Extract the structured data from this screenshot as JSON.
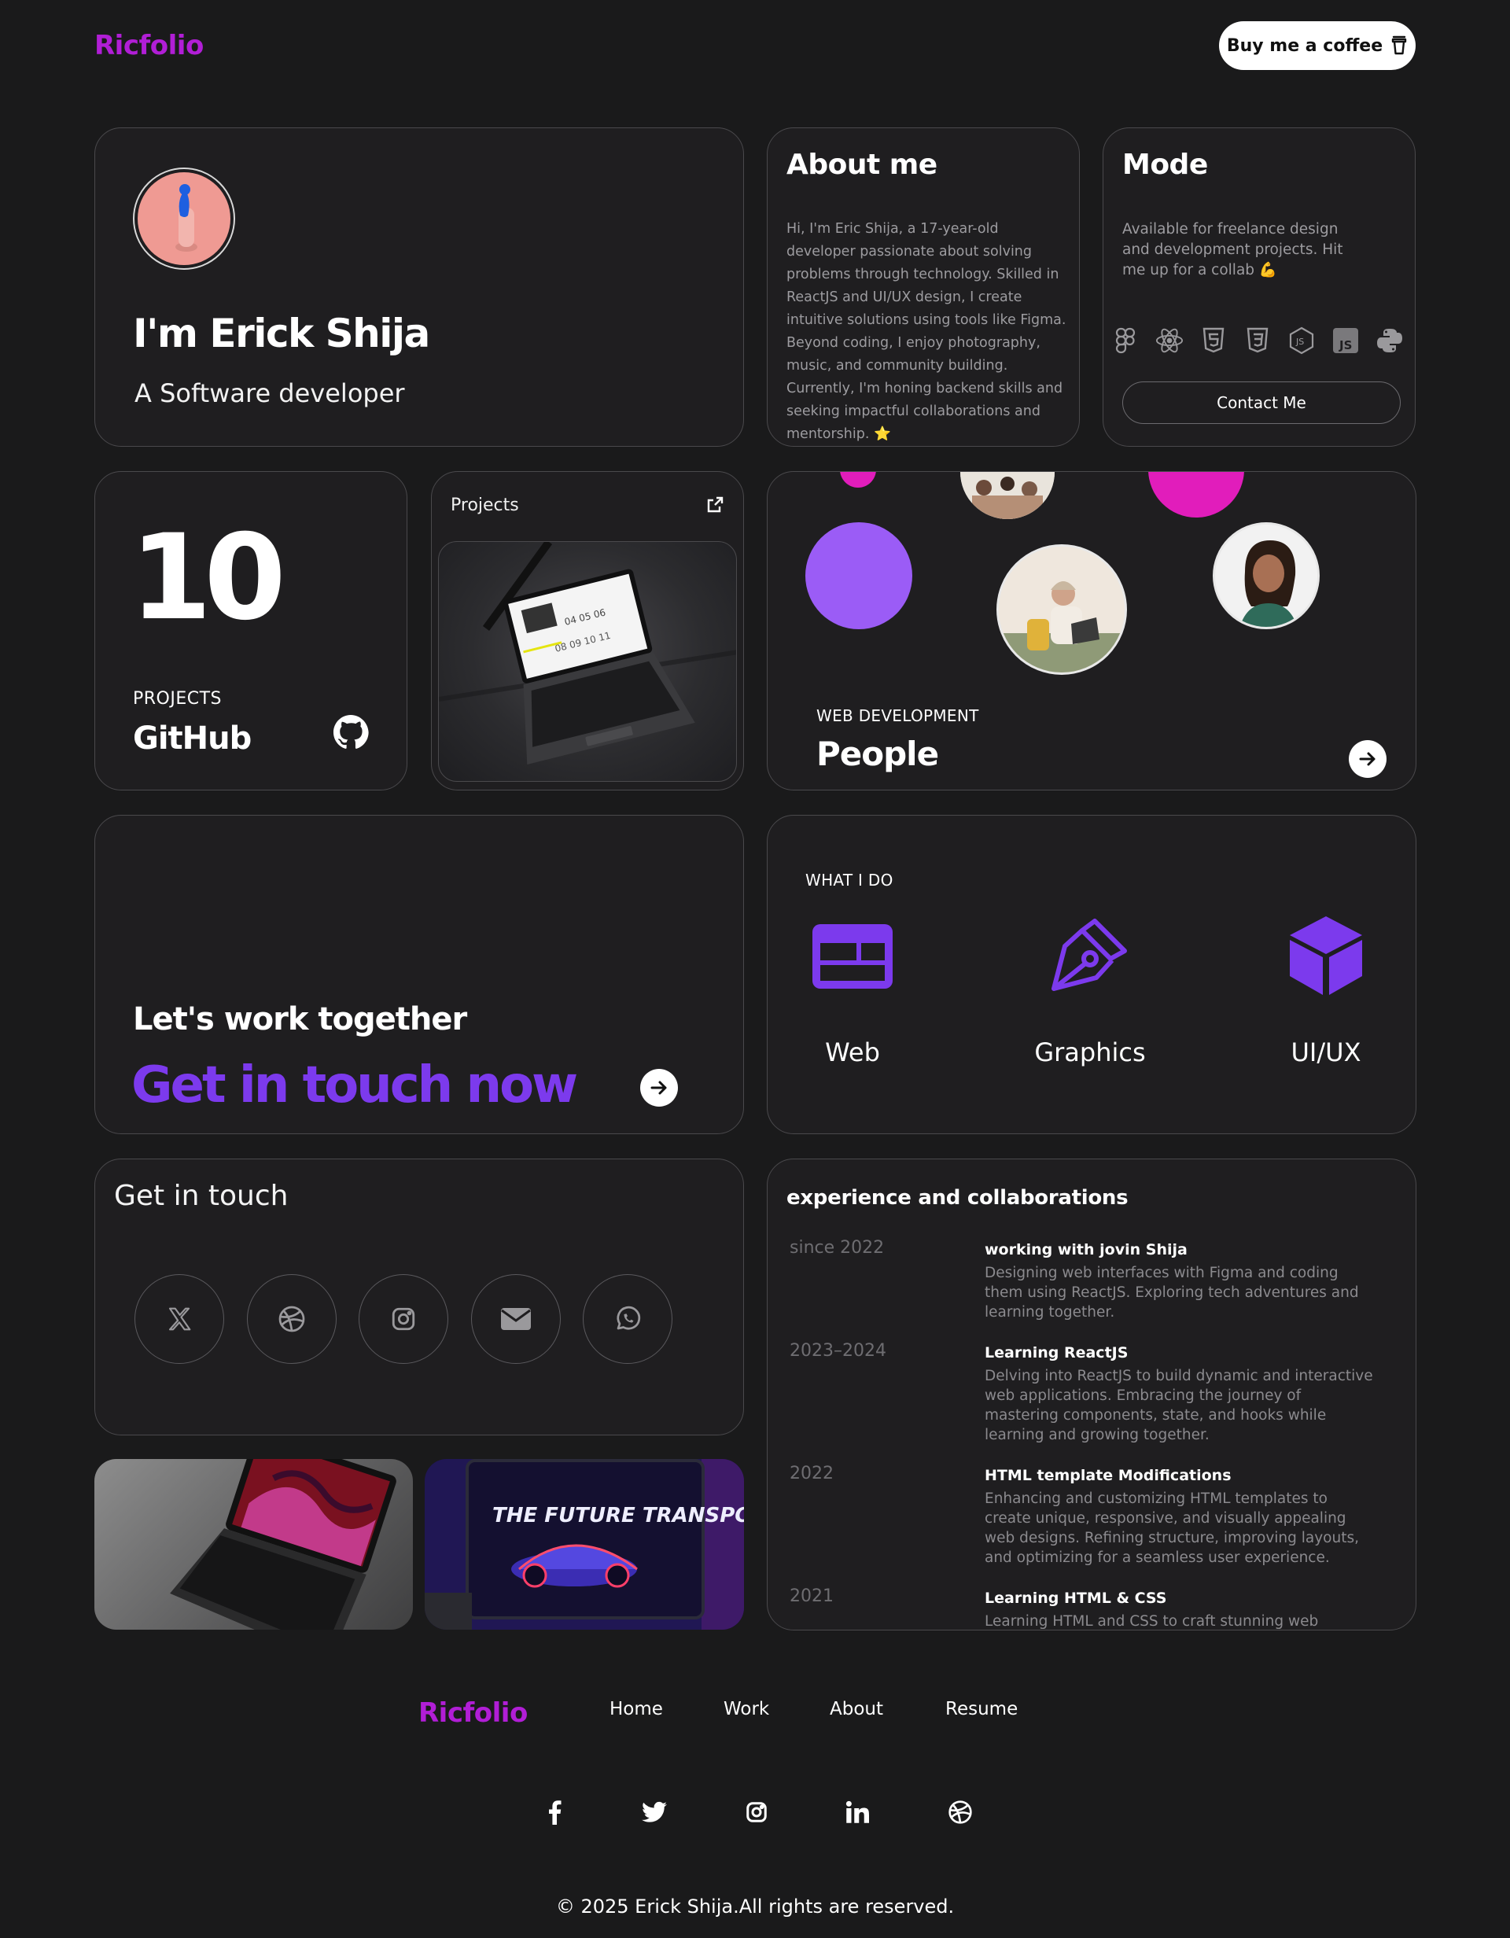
{
  "header": {
    "logo": "Ricfolio",
    "coffee_label": "Buy me a coffee"
  },
  "intro": {
    "name": "I'm Erick Shija",
    "role": "A Software developer"
  },
  "about": {
    "title": "About me",
    "text": "Hi, I'm Eric Shija, a 17-year-old developer passionate about solving problems through technology. Skilled in ReactJS and UI/UX design, I create intuitive solutions using tools like Figma. Beyond coding, I enjoy photography, music, and community building. Currently, I'm honing backend skills and seeking impactful collaborations and mentorship. ⭐"
  },
  "mode": {
    "title": "Mode",
    "text": "Available for freelance design and development projects. Hit me up for a collab 💪",
    "icons": [
      "figma-icon",
      "react-icon",
      "html5-icon",
      "css3-icon",
      "nodejs-icon",
      "javascript-icon",
      "python-icon"
    ],
    "contact_label": "Contact Me"
  },
  "stats": {
    "count": "10",
    "label": "PROJECTS",
    "platform": "GitHub"
  },
  "projects": {
    "title": "Projects"
  },
  "people": {
    "eyebrow": "WEB DEVELOPMENT",
    "title": "People"
  },
  "cta": {
    "line1": "Let's work together",
    "line2": "Get in touch now"
  },
  "services": {
    "eyebrow": "WHAT I DO",
    "items": [
      {
        "label": "Web",
        "icon": "web-layout-icon"
      },
      {
        "label": "Graphics",
        "icon": "pen-tool-icon"
      },
      {
        "label": "UI/UX",
        "icon": "cube-icon"
      }
    ]
  },
  "contact": {
    "title": "Get in touch",
    "icons": [
      "x-icon",
      "dribbble-icon",
      "instagram-icon",
      "email-icon",
      "whatsapp-icon"
    ]
  },
  "experience": {
    "title": "experience and collaborations",
    "items": [
      {
        "year": "since 2022",
        "title": "working with jovin Shija",
        "desc": "Designing web interfaces with Figma and coding them using ReactJS. Exploring tech adventures and learning together."
      },
      {
        "year": "2023–2024",
        "title": "Learning ReactJS",
        "desc": "Delving into ReactJS to build dynamic and interactive web applications. Embracing the journey of mastering components, state, and hooks while learning and growing together."
      },
      {
        "year": "2022",
        "title": "HTML template Modifications",
        "desc": "Enhancing and customizing HTML templates to create unique, responsive, and visually appealing web designs. Refining structure, improving layouts, and optimizing for a seamless user experience."
      },
      {
        "year": "2021",
        "title": "Learning HTML & CSS",
        "desc": "Learning HTML and CSS to craft stunning web"
      }
    ]
  },
  "showcase": {
    "headline": "THE FUTURE TRANSPORTATION"
  },
  "footer": {
    "logo": "Ricfolio",
    "nav": [
      "Home",
      "Work",
      "About",
      "Resume"
    ],
    "social": [
      "facebook-icon",
      "twitter-icon",
      "instagram-icon",
      "linkedin-icon",
      "dribbble-icon"
    ],
    "copyright": "© 2025 Erick Shija.All rights are reserved."
  },
  "colors": {
    "bg": "#1a1a1b",
    "accent": "#7c3aed",
    "logo": "#b11ed6",
    "magenta": "#e11dbb"
  }
}
